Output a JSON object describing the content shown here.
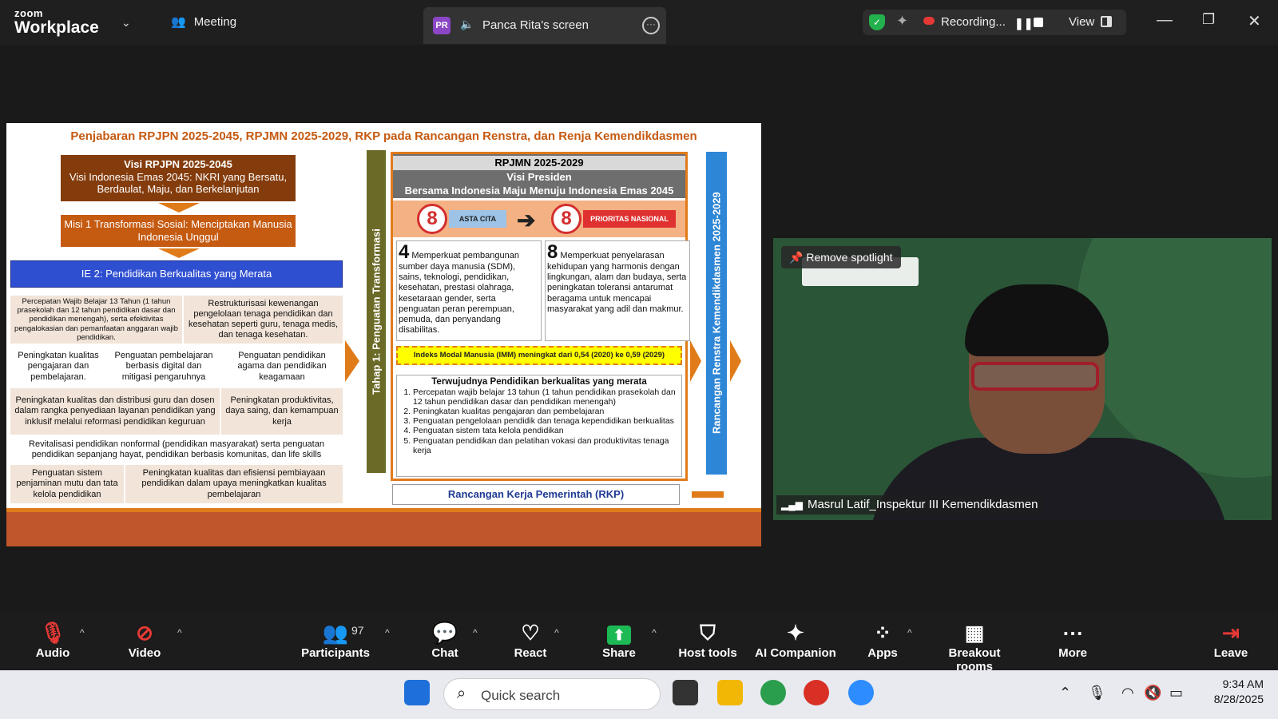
{
  "app": {
    "brand_top": "zoom",
    "brand_bottom": "Workplace",
    "meeting_label": "Meeting"
  },
  "share": {
    "initials": "PR",
    "label": "Panca Rita's screen"
  },
  "recording": {
    "label": "Recording...",
    "view_label": "View"
  },
  "slide": {
    "title": "Penjabaran RPJPN 2025-2045, RPJMN 2025-2029, RKP pada Rancangan Renstra, dan Renja Kemendikdasmen",
    "visi_title": "Visi RPJPN 2025-2045",
    "visi_text": "Visi Indonesia Emas 2045: NKRI yang Bersatu, Berdaulat, Maju, dan Berkelanjutan",
    "misi": "Misi 1 Transformasi Sosial: Menciptakan Manusia Indonesia Unggul",
    "ie2": "IE 2: Pendidikan Berkualitas yang Merata",
    "cells": {
      "c1": "Percepatan Wajib Belajar 13 Tahun (1 tahun prasekolah dan 12 tahun pendidikan dasar dan pendidikan menengah), serta efektivitas pengalokasian dan pemanfaatan anggaran wajib pendidikan.",
      "c2": "Restrukturisasi kewenangan pengelolaan tenaga pendidikan dan kesehatan seperti guru, tenaga medis, dan tenaga kesehatan.",
      "c3": "Peningkatan kualitas pengajaran dan pembelajaran.",
      "c4": "Penguatan pembelajaran berbasis digital dan mitigasi pengaruhnya",
      "c5": "Penguatan pendidikan agama dan pendidikan keagamaan",
      "c6": "Peningkatan kualitas dan distribusi guru dan dosen dalam rangka penyediaan layanan pendidikan yang inklusif melalui reformasi pendidikan keguruan",
      "c7": "Peningkatan produktivitas, daya saing, dan kemampuan kerja",
      "c8": "Revitalisasi pendidikan nonformal (pendidikan masyarakat) serta penguatan pendidikan sepanjang hayat, pendidikan berbasis komunitas, dan life skills",
      "c9": "Penguatan sistem penjaminan mutu dan tata kelola pendidikan",
      "c10": "Peningkatan kualitas dan efisiensi pembiayaan pendidikan dalam upaya meningkatkan kualitas pembelajaran"
    },
    "tahap": "Tahap 1: Penguatan Transformasi",
    "rpjmn_title": "RPJMN 2025-2029",
    "visi_presiden": "Visi Presiden",
    "visi_presiden_text": "Bersama Indonesia Maju Menuju Indonesia Emas 2045",
    "asta_cita": "ASTA CITA",
    "prioritas": "PRIORITAS NASIONAL",
    "eight": "8",
    "p4_num": "4",
    "p4_text": "Memperkuat pembangunan sumber daya manusia (SDM), sains, teknologi, pendidikan, kesehatan, prestasi olahraga, kesetaraan gender, serta penguatan peran perempuan, pemuda, dan penyandang disabilitas.",
    "p8_num": "8",
    "p8_text": "Memperkuat penyelarasan kehidupan yang harmonis dengan lingkungan, alam dan budaya, serta peningkatan toleransi antarumat beragama untuk mencapai masyarakat yang adil dan makmur.",
    "imm": "Indeks Modal Manusia (IMM) meningkat dari 0,54 (2020) ke 0,59 (2029)",
    "goal_title": "Terwujudnya Pendidikan berkualitas yang merata",
    "goals": [
      "Percepatan wajib belajar 13 tahun (1 tahun pendidikan prasekolah dan 12 tahun pendidikan dasar dan pendidikan menengah)",
      "Peningkatan kualitas pengajaran dan pembelajaran",
      "Penguatan pengelolaan pendidik dan tenaga kependidikan berkualitas",
      "Penguatan sistem tata kelola pendidikan",
      "Penguatan pendidikan dan pelatihan vokasi dan produktivitas tenaga kerja"
    ],
    "rkp": "Rancangan Kerja Pemerintah (RKP)",
    "renstra": "Rancangan Renstra Kemendikdasmen 2025-2029"
  },
  "video": {
    "spotlight": "Remove spotlight",
    "name": "Masrul Latif_Inspektur III Kemendikdasmen"
  },
  "toolbar": {
    "audio": "Audio",
    "video": "Video",
    "participants": "Participants",
    "participants_count": "97",
    "chat": "Chat",
    "react": "React",
    "share": "Share",
    "host_tools": "Host tools",
    "ai": "AI Companion",
    "apps": "Apps",
    "breakout": "Breakout rooms",
    "more": "More",
    "leave": "Leave"
  },
  "taskbar": {
    "search_placeholder": "Quick search",
    "time": "9:34 AM",
    "date": "8/28/2025"
  },
  "colors": {
    "accent_orange": "#e07b1a",
    "share_green": "#1db954",
    "brown": "#843c0c",
    "blue": "#2f4fd1"
  }
}
